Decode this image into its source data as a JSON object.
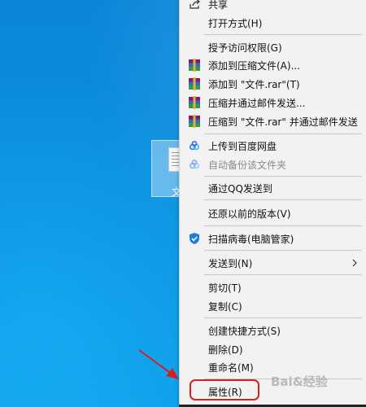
{
  "desktop": {
    "file_label": "文"
  },
  "menu": {
    "items": [
      {
        "label": "共享",
        "icon": "share-icon"
      },
      {
        "label": "打开方式(H)"
      },
      {
        "label": "授予访问权限(G)"
      },
      {
        "label": "添加到压缩文件(A)...",
        "icon": "winrar-icon"
      },
      {
        "label": "添加到 \"文件.rar\"(T)",
        "icon": "winrar-icon"
      },
      {
        "label": "压缩并通过邮件发送...",
        "icon": "winrar-icon"
      },
      {
        "label": "压缩到 \"文件.rar\" 并通过邮件发送",
        "icon": "winrar-icon"
      },
      {
        "label": "上传到百度网盘",
        "icon": "baidu-netdisk-icon"
      },
      {
        "label": "自动备份该文件夹",
        "icon": "baidu-netdisk-icon",
        "disabled": true
      },
      {
        "label": "通过QQ发送到"
      },
      {
        "label": "还原以前的版本(V)"
      },
      {
        "label": "扫描病毒(电脑管家)",
        "icon": "tencent-pc-manager-icon"
      },
      {
        "label": "发送到(N)"
      },
      {
        "label": "剪切(T)"
      },
      {
        "label": "复制(C)"
      },
      {
        "label": "创建快捷方式(S)"
      },
      {
        "label": "删除(D)"
      },
      {
        "label": "重命名(M)"
      },
      {
        "label": "属性(R)"
      }
    ]
  },
  "watermark": "Bai&经验",
  "colors": {
    "desktop": "#0b8fdf",
    "menu_background": "#f2f2f2",
    "annotation_red": "#d62020"
  }
}
